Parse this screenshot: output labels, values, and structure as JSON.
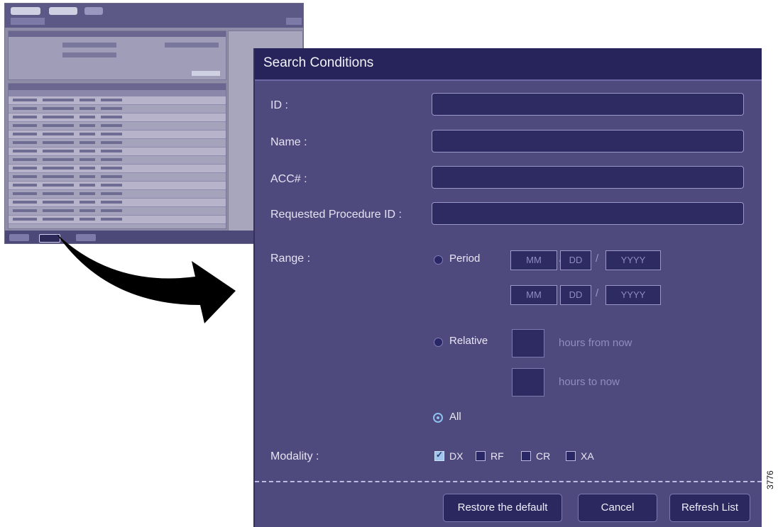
{
  "dialog": {
    "title": "Search Conditions",
    "fields": [
      {
        "label": "ID :",
        "value": ""
      },
      {
        "label": "Name :",
        "value": ""
      },
      {
        "label": "ACC# :",
        "value": ""
      },
      {
        "label": "Requested Procedure ID :",
        "value": ""
      }
    ],
    "range": {
      "label": "Range :",
      "period_label": "Period",
      "date_placeholders": {
        "month": "MM",
        "day": "DD",
        "year": "YYYY"
      },
      "date_separator": "/",
      "relative_label": "Relative",
      "hours_from_now": "hours from now",
      "hours_to_now": "hours to now",
      "all_label": "All",
      "selected": "All"
    },
    "modality": {
      "label": "Modality :",
      "options": [
        {
          "name": "DX",
          "checked": true
        },
        {
          "name": "RF",
          "checked": false
        },
        {
          "name": "CR",
          "checked": false
        },
        {
          "name": "XA",
          "checked": false
        }
      ]
    },
    "buttons": {
      "restore": "Restore the default",
      "cancel": "Cancel",
      "refresh": "Refresh List"
    }
  },
  "figure_code": "3776",
  "colors": {
    "dialog_bg": "#4e4a7e",
    "title_bg": "#26245a",
    "field_bg": "#2e2b63",
    "accent": "#8ec0f0"
  }
}
